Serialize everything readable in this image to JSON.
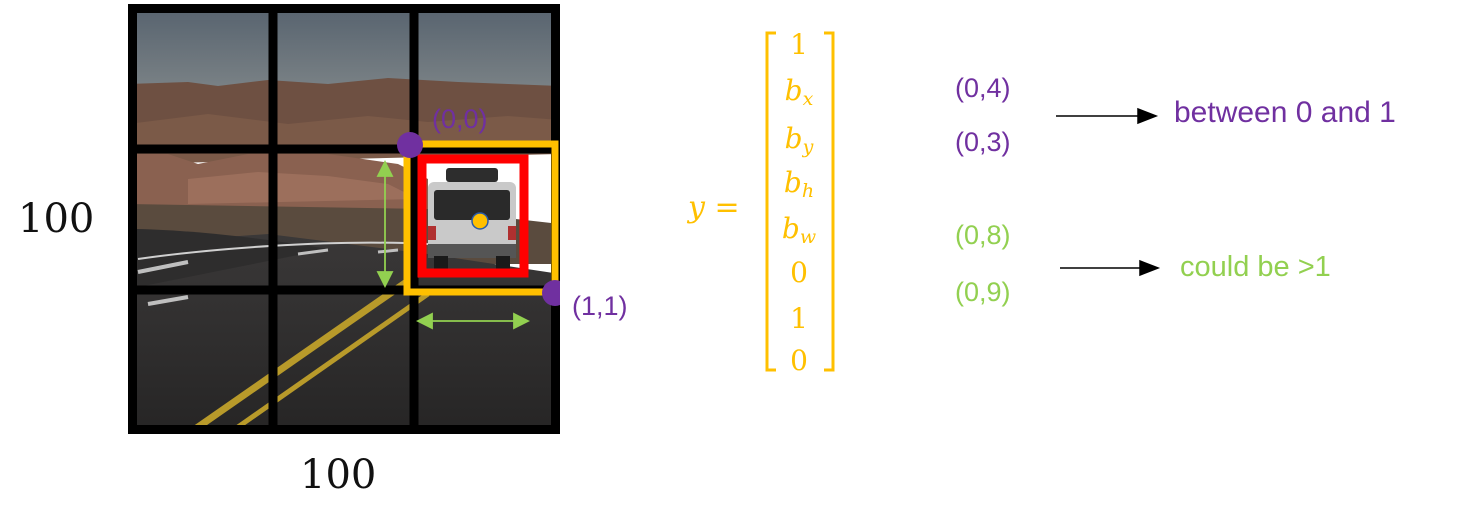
{
  "image": {
    "width_label": "100",
    "height_label": "100",
    "grid": "3x3",
    "box_colors": {
      "outer": "#ffc000",
      "inner": "#ff0000",
      "corner_dots": "#7030a0",
      "center_dot": "#ffc000",
      "size_arrows": "#92d050"
    },
    "corner_top_left": "(0,0)",
    "corner_bottom_right": "(1,1)"
  },
  "vector": {
    "lhs": "y =",
    "entries": [
      {
        "base": "1",
        "sub": ""
      },
      {
        "base": "b",
        "sub": "x"
      },
      {
        "base": "b",
        "sub": "y"
      },
      {
        "base": "b",
        "sub": "h"
      },
      {
        "base": "b",
        "sub": "w"
      },
      {
        "base": "0",
        "sub": ""
      },
      {
        "base": "1",
        "sub": ""
      },
      {
        "base": "0",
        "sub": ""
      }
    ]
  },
  "values": {
    "bx": "(0,4)",
    "by": "(0,3)",
    "bh": "(0,8)",
    "bw": "(0,9)"
  },
  "notes": {
    "position_range": "between 0 and 1",
    "size_range": "could be >1"
  },
  "colors": {
    "purple": "#7030a0",
    "green": "#92d050",
    "gold": "#ffc000",
    "red": "#ff0000"
  }
}
